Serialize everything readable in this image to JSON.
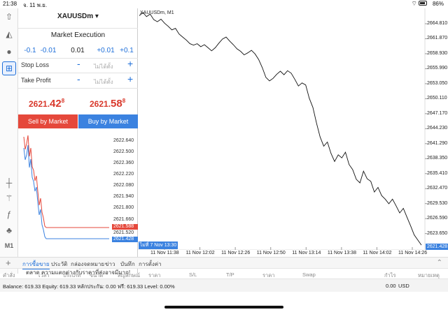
{
  "status": {
    "time": "21:38",
    "date": "จ. 11 พ.ย.",
    "battery": "86%"
  },
  "order": {
    "symbol": "XAUUSDm",
    "mode": "Market Execution",
    "volume_steps": [
      "-0.1",
      "-0.01",
      "0.01",
      "+0.01",
      "+0.1"
    ],
    "stop_loss": {
      "label": "Stop Loss",
      "placeholder": "ไม่ได้ตั้ง"
    },
    "take_profit": {
      "label": "Take Profit",
      "placeholder": "ไม่ได้ตั้ง"
    },
    "bid": {
      "main": "2621.",
      "big": "42",
      "sup": "8"
    },
    "ask": {
      "main": "2621.",
      "big": "58",
      "sup": "8"
    },
    "sell_label": "Sell by Market",
    "buy_label": "Buy by Market",
    "warning": "คำเตือน! การซื้อขายจะถูกดำเนินการตามสภาพตลาด ความแตกต่างกับราคาที่ส่งอาจมีมาก!"
  },
  "mini_chart": {
    "ticks": [
      "2622.640",
      "2622.500",
      "2622.360",
      "2622.220",
      "2622.080",
      "2621.940",
      "2621.800",
      "2621.660",
      "2621.520"
    ],
    "ask_tag": "2621.588",
    "bid_tag": "2621.428",
    "ask_color": "#e5483b",
    "bid_color": "#3b82e0"
  },
  "chart": {
    "title": "XAUUSDm, M1",
    "price_tag": "2621.428",
    "cursor_time": "ไม่ที่ 7 Nov 13:30",
    "accent": "#3b82e0"
  },
  "chart_data": {
    "type": "line",
    "title": "XAUUSDm, M1",
    "xlabel": "",
    "ylabel": "",
    "x_ticks": [
      "11 Nov 11:38",
      "11 Nov 12:02",
      "11 Nov 12:26",
      "11 Nov 12:50",
      "11 Nov 13:14",
      "11 Nov 13:38",
      "11 Nov 14:02",
      "11 Nov 14:26"
    ],
    "y_ticks": [
      "2664.810",
      "2661.870",
      "2658.930",
      "2655.990",
      "2653.050",
      "2650.110",
      "2647.170",
      "2644.230",
      "2641.290",
      "2638.350",
      "2635.410",
      "2632.470",
      "2629.530",
      "2626.590",
      "2623.650"
    ],
    "ylim": [
      2621.0,
      2667.0
    ],
    "series": [
      {
        "values": [
          2666.4,
          2667.0,
          2666.2,
          2666.7,
          2665.6,
          2665.2,
          2665.7,
          2664.9,
          2664.3,
          2663.6,
          2663.9,
          2662.8,
          2662.2,
          2661.6,
          2660.9,
          2660.6,
          2660.9,
          2660.3,
          2660.7,
          2660.1,
          2659.5,
          2660.1,
          2661.0,
          2661.8,
          2662.2,
          2661.4,
          2660.7,
          2659.9,
          2659.4,
          2658.7,
          2659.1,
          2659.6,
          2658.9,
          2657.8,
          2656.2,
          2654.3,
          2653.6,
          2654.1,
          2654.9,
          2655.5,
          2654.8,
          2655.6,
          2655.1,
          2653.9,
          2652.6,
          2653.2,
          2652.8,
          2650.2,
          2648.4,
          2645.3,
          2642.6,
          2640.8,
          2641.6,
          2639.4,
          2637.8,
          2639.1,
          2638.5,
          2639.6,
          2637.2,
          2636.2,
          2634.3,
          2633.6,
          2635.9,
          2634.4,
          2633.9,
          2631.8,
          2632.7,
          2631.1,
          2630.4,
          2629.5,
          2630.4,
          2629.1,
          2627.7,
          2628.6,
          2626.9,
          2625.2,
          2623.4,
          2622.4,
          2621.4
        ]
      }
    ]
  },
  "bottom": {
    "tabs": [
      "การซื้อขาย",
      "ประวัติ",
      "กล่องจดหมาย",
      "ข่าว",
      "บันทึก",
      "การตั้งค่า"
    ],
    "columns": [
      "คำสั่ง",
      "เวลา",
      "ประเภท",
      "ขนาด",
      "สัญลักษณ์",
      "ราคา",
      "S/L",
      "T/P",
      "ราคา",
      "Swap",
      "กำไร",
      "หมายเหตุ"
    ],
    "balance_text": "Balance: 619.33 Equity: 619.33 หลักประกัน: 0.00 ฟรี: 619.33 Level: 0.00%",
    "profit": "0.00",
    "currency": "USD"
  },
  "icons": [
    "person-up-icon",
    "chat-icon",
    "new-order-icon",
    "crosshair-icon",
    "indicators-icon",
    "function-icon",
    "objects-icon",
    "timeframe-icon"
  ]
}
